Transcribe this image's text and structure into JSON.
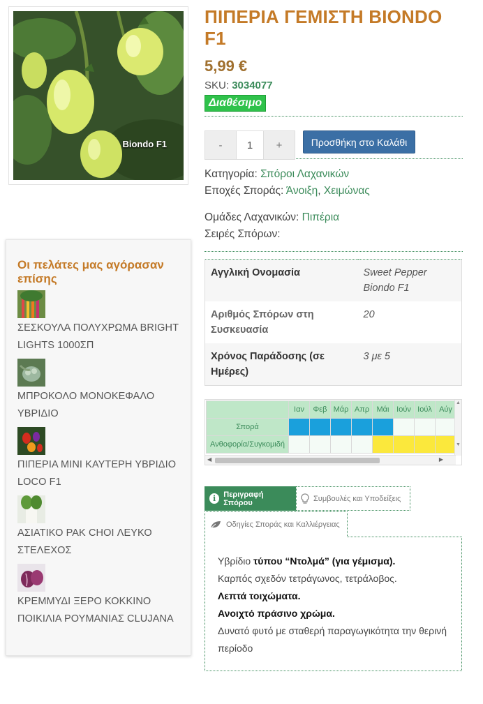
{
  "product": {
    "title": "ΠΙΠΕΡΙΑ ΓΕΜΙΣΤΗ BIONDO F1",
    "image_caption": "Biondo F1",
    "price": "5,99 €",
    "sku_label": "SKU:",
    "sku": "3034077",
    "stock": "Διαθέσιμο"
  },
  "cart": {
    "minus": "-",
    "quantity": "1",
    "plus": "+",
    "add_label": "Προσθήκη στο Καλάθι"
  },
  "meta": {
    "category_label": "Κατηγορία:",
    "category": "Σπόροι Λαχανικών",
    "season_label": "Εποχές Σποράς:",
    "season_1": "Άνοιξη",
    "separator": ",",
    "season_2": "Χειμώνας",
    "group_label": "Ομάδες Λαχανικών:",
    "group": "Πιπέρια",
    "series_label": "Σειρές Σπόρων:"
  },
  "attributes": [
    {
      "label": "Αγγλική Ονομασία",
      "value": "Sweet Pepper Biondo F1"
    },
    {
      "label": "Αριθμός Σπόρων στη Συσκευασία",
      "value": "20"
    },
    {
      "label": "Χρόνος Παράδοσης (σε Ημέρες)",
      "value": "3 με 5"
    }
  ],
  "calendar": {
    "months": [
      "Ιαν",
      "Φεβ",
      "Μάρ",
      "Απρ",
      "Μάι",
      "Ιούν",
      "Ιούλ",
      "Αύγ"
    ],
    "rows": [
      {
        "label": "Σπορά",
        "months": [
          "sow",
          "sow",
          "sow",
          "sow",
          "sow",
          "empty",
          "empty",
          "empty"
        ]
      },
      {
        "label": "Ανθοφορία/Συγκομιδή",
        "months": [
          "empty",
          "empty",
          "empty",
          "empty",
          "harvest",
          "harvest",
          "harvest",
          "harvest"
        ]
      }
    ],
    "colors": {
      "sow": "#1aa0dc",
      "harvest": "#fbe83c",
      "empty": "#f4fbf6"
    }
  },
  "tabs": [
    {
      "label": "Περιγραφή Σπόρου",
      "icon": "info-icon"
    },
    {
      "label": "Συμβουλές και Υποδείξεις",
      "icon": "lightbulb-icon"
    },
    {
      "label": "Οδηγίες Σποράς και Καλλιέργειας",
      "icon": "leaf-icon"
    }
  ],
  "description": {
    "line1_plain": "Υβρίδιο ",
    "line1_bold": "τύπου “Ντολμά” (για γέμισμα).",
    "line2": "Καρπός σχεδόν τετράγωνος, τετράλοβος.",
    "line3": "Λεπτά τοιχώματα.",
    "line4": "Ανοιχτό πράσινο χρώμα.",
    "line5": "Δυνατό φυτό με σταθερή παραγωγικότητα την θερινή περίοδο"
  },
  "sidebar": {
    "title": "Οι πελάτες μας αγόρασαν επίσης",
    "items": [
      {
        "title": "ΣΕΣΚΟΥΛΑ ΠΟΛΥΧΡΩΜΑ BRIGHT LIGHTS 1000σπ"
      },
      {
        "title": "ΜΠΡΟΚΟΛΟ ΜΟΝΟΚΕΦΑΛΟ ΥΒΡΙΔΙΟ"
      },
      {
        "title": "ΠΙΠΕΡΙΑ ΜΙΝΙ ΚΑΥΤΕΡΗ ΥΒΡΙΔΙΟ LOCO F1"
      },
      {
        "title": "ΑΣΙΑΤΙΚΟ ΡΑΚ CHOI ΛΕΥΚΟ ΣΤΕΛΕΧΟΣ"
      },
      {
        "title": "ΚΡΕΜΜΥΔΙ ΞΕΡΟ ΚΟΚΚΙΝΟ ΠΟΙΚΙΛΙΑ ΡΟΥΜΑΝΙΑΣ CLUJANA"
      }
    ]
  }
}
